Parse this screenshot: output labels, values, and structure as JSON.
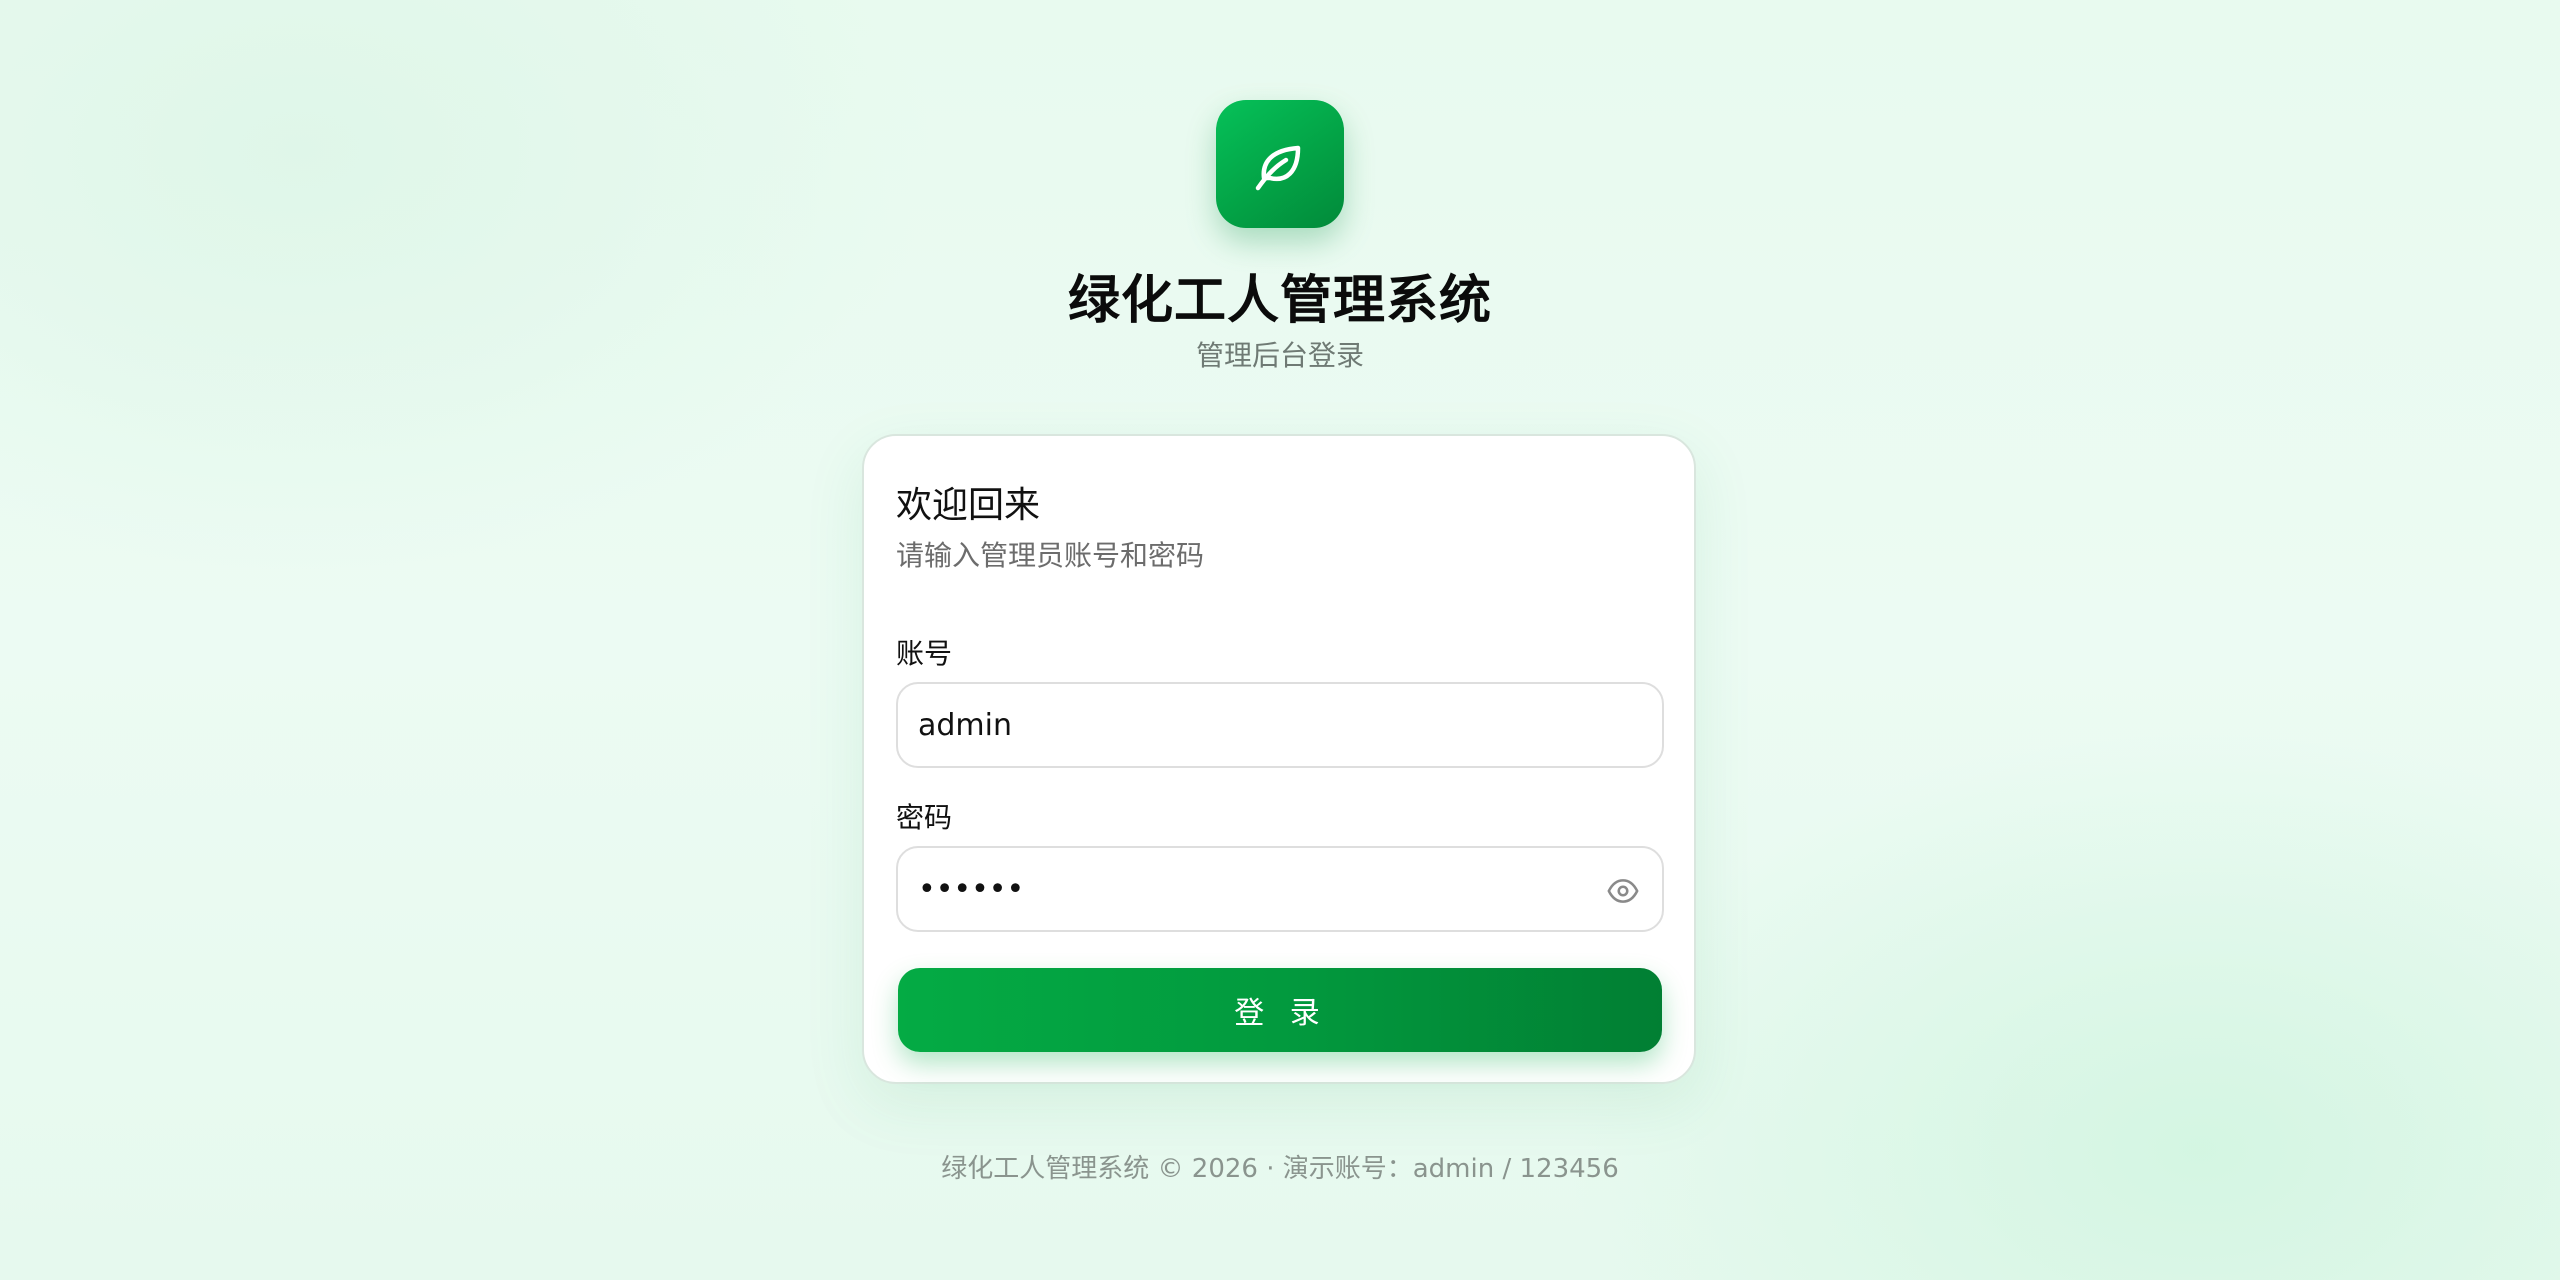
{
  "app": {
    "title": "绿化工人管理系统",
    "subtitle": "管理后台登录",
    "logo_icon": "leaf-icon",
    "accent_color": "#04ab44"
  },
  "card": {
    "welcome": "欢迎回来",
    "hint": "请输入管理员账号和密码",
    "account": {
      "label": "账号",
      "value": "admin"
    },
    "password": {
      "label": "密码",
      "value": "123456",
      "toggle_icon": "eye-icon"
    },
    "login_label": "登 录"
  },
  "footer": {
    "text": "绿化工人管理系统 © 2026 · 演示账号：admin / 123456"
  }
}
